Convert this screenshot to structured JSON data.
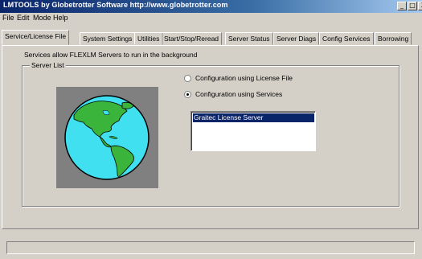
{
  "window": {
    "title": "LMTOOLS by Globetrotter Software http://www.globetrotter.com",
    "minimize_glyph": "_",
    "maximize_glyph": "□",
    "close_glyph": "3"
  },
  "menu": [
    "File",
    "Edit",
    "Mode",
    "Help"
  ],
  "tabs": [
    "Service/License File",
    "System Settings",
    "Utilities",
    "Start/Stop/Reread",
    "Server Status",
    "Server Diags",
    "Config Services",
    "Borrowing"
  ],
  "active_tab": "Service/License File",
  "page": {
    "description": "Services allow FLEXLM Servers to run in the background",
    "group_label": "Server List",
    "radio_license_file": "Configuration using License File",
    "radio_services": "Configuration using Services",
    "selected_radio": "radio_services",
    "services": [
      "Graitec License Server"
    ],
    "selected_service": "Graitec License Server"
  },
  "status": "",
  "colors": {
    "titlebar_start": "#0a246a",
    "selection": "#0a246a",
    "globe_water": "#40e0f0",
    "globe_land": "#3ab43a"
  }
}
